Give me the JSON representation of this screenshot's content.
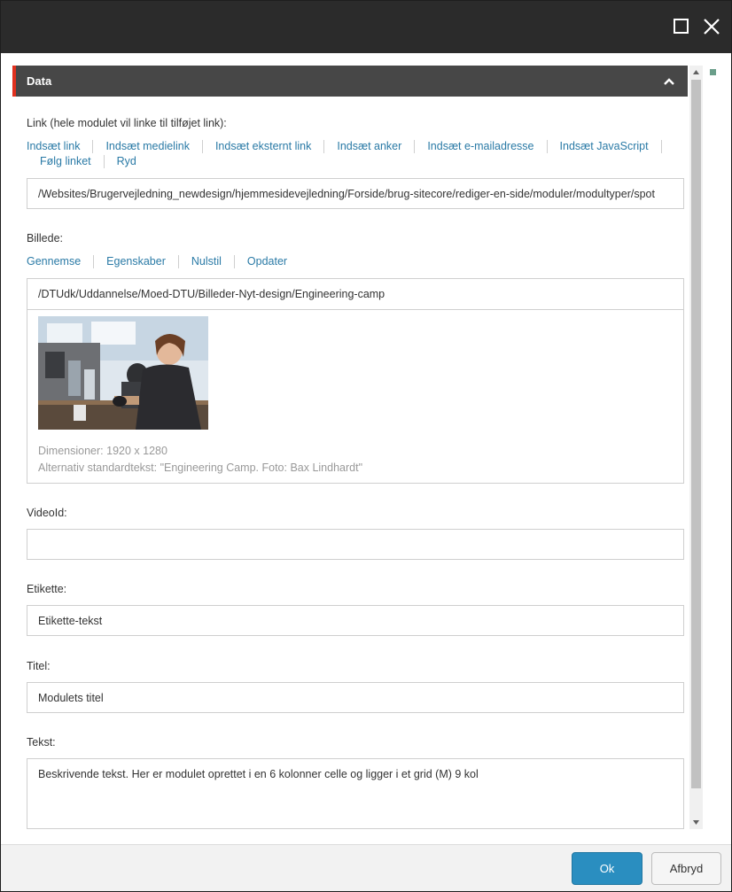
{
  "window": {
    "maximize_icon": "maximize-icon",
    "close_icon": "close-icon"
  },
  "section": {
    "title": "Data",
    "collapse_icon": "chevron-up-icon"
  },
  "link_field": {
    "label": "Link (hele modulet vil linke til tilføjet link):",
    "actions": [
      "Indsæt link",
      "Indsæt medielink",
      "Indsæt eksternt link",
      "Indsæt anker",
      "Indsæt e-mailadresse",
      "Indsæt JavaScript",
      "Følg linket",
      "Ryd"
    ],
    "value": "/Websites/Brugervejledning_newdesign/hjemmesidevejledning/Forside/brug-sitecore/rediger-en-side/moduler/modultyper/spot"
  },
  "image_field": {
    "label": "Billede:",
    "actions": [
      "Gennemse",
      "Egenskaber",
      "Nulstil",
      "Opdater"
    ],
    "path": "/DTUdk/Uddannelse/Moed-DTU/Billeder-Nyt-design/Engineering-camp",
    "dimensions": "Dimensioner: 1920 x 1280",
    "alt_text": "Alternativ standardtekst: \"Engineering Camp. Foto: Bax Lindhardt\""
  },
  "video_field": {
    "label": "VideoId:",
    "value": ""
  },
  "tag_field": {
    "label": "Etikette:",
    "value": "Etikette-tekst"
  },
  "title_field": {
    "label": "Titel:",
    "value": "Modulets titel"
  },
  "text_field": {
    "label": "Tekst:",
    "value": "Beskrivende tekst. Her er modulet oprettet i en 6 kolonner celle og ligger i et grid (M) 9 kol"
  },
  "footer": {
    "ok_label": "Ok",
    "cancel_label": "Afbryd"
  },
  "colors": {
    "titlebar": "#2b2b2b",
    "section_header": "#474747",
    "section_accent": "#e0301e",
    "link": "#2a7aa6",
    "primary_button": "#2a8ec0"
  }
}
